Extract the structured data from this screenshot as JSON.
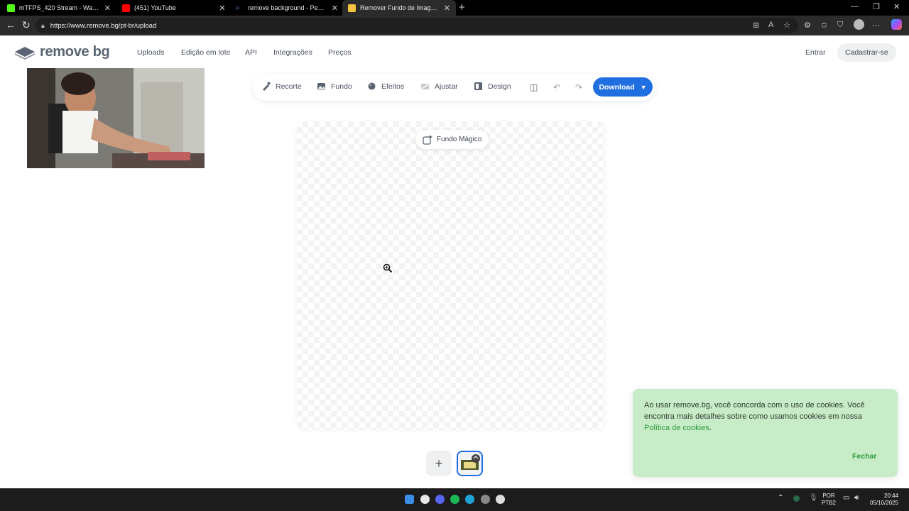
{
  "browser": {
    "tabs": [
      {
        "title": "mTFPS_420 Stream - Watch Live o",
        "color": "#53fc18"
      },
      {
        "title": "(451) YouTube",
        "color": "#ff0000"
      },
      {
        "title": "remove background - Pesquisar",
        "color": "#4a8cff"
      },
      {
        "title": "Remover Fundo de Imagem Onli",
        "color": "#f5c542"
      }
    ],
    "url": "https://www.remove.bg/pt-br/upload"
  },
  "site": {
    "logo_text": "remove bg",
    "nav": [
      "Uploads",
      "Edição em lote",
      "API",
      "Integrações",
      "Preços"
    ],
    "login": "Entrar",
    "signup": "Cadastrar-se"
  },
  "toolbar": {
    "tools": [
      "Recorte",
      "Fundo",
      "Efeitos",
      "Ajustar",
      "Design"
    ],
    "download": "Download"
  },
  "canvas": {
    "magic_label": "Fundo Mágico"
  },
  "cookie": {
    "text": "Ao usar remove.bg, você concorda com o uso de cookies. Você encontra mais detalhes sobre como usamos cookies em nossa",
    "link": "Política de cookies",
    "period": ".",
    "close": "Fechar"
  },
  "taskbar": {
    "lang_top": "POR",
    "lang_bottom": "PTB2",
    "time": "20:44",
    "date": "05/10/2025"
  },
  "colors": {
    "accent": "#1f6fe0",
    "cookie_bg": "#c8ecc8",
    "cookie_link": "#2a9a3a"
  }
}
